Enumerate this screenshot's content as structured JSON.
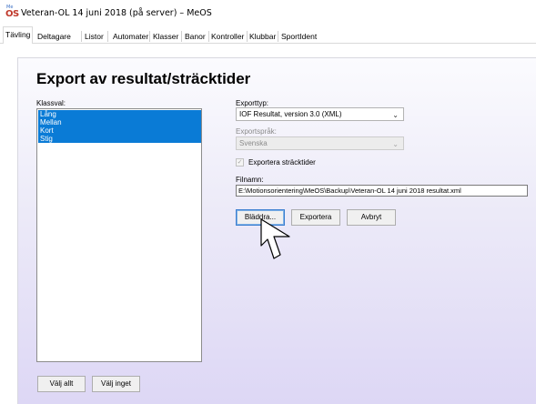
{
  "window": {
    "title": "Veteran-OL 14 juni 2018 (på server) – MeOS",
    "icon": {
      "name": "meos-app-icon",
      "top_text": "Me",
      "bottom_text": "OS"
    }
  },
  "tabs": [
    {
      "label": "Tävling"
    },
    {
      "label": "Deltagare"
    },
    {
      "label": "Listor"
    },
    {
      "label": "Automater"
    },
    {
      "label": "Klasser"
    },
    {
      "label": "Banor"
    },
    {
      "label": "Kontroller"
    },
    {
      "label": "Klubbar"
    },
    {
      "label": "SportIdent"
    }
  ],
  "page": {
    "heading": "Export av resultat/sträcktider"
  },
  "class_selection": {
    "label": "Klassval:",
    "items": [
      "Lång",
      "Mellan",
      "Kort",
      "Stig"
    ],
    "select_all_label": "Välj allt",
    "select_none_label": "Välj inget"
  },
  "export": {
    "type_label": "Exporttyp:",
    "type_value": "IOF Resultat, version 3.0 (XML)",
    "language_label": "Exportspråk:",
    "language_value": "Svenska",
    "export_splits_label": "Exportera sträcktider",
    "export_splits_checked": true,
    "filename_label": "Filnamn:",
    "filename_value": "E:\\Motionsorientering\\MeOS\\Backup\\Veteran-OL 14 juni 2018 resultat.xml",
    "browse_label": "Bläddra...",
    "export_label": "Exportera",
    "cancel_label": "Avbryt"
  },
  "colors": {
    "selection": "#0a7bd6",
    "panel_gradient_end": "#ddd7f5"
  }
}
